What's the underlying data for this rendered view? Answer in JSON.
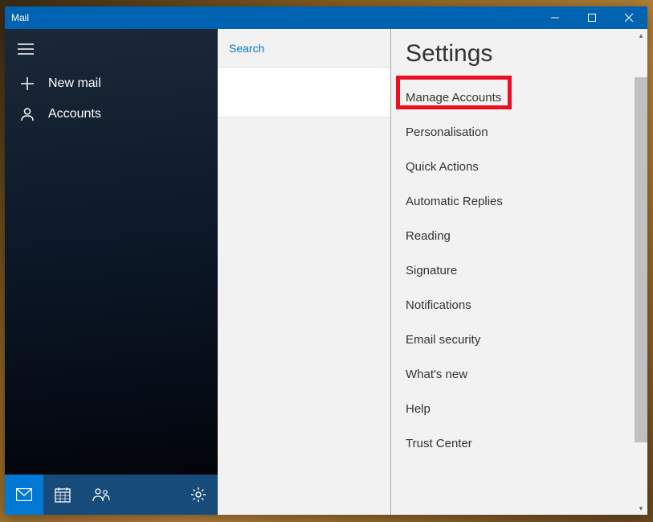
{
  "titlebar": {
    "title": "Mail"
  },
  "sidebar": {
    "new_mail": "New mail",
    "accounts": "Accounts"
  },
  "search": {
    "placeholder": "Search"
  },
  "settings": {
    "title": "Settings",
    "items": [
      "Manage Accounts",
      "Personalisation",
      "Quick Actions",
      "Automatic Replies",
      "Reading",
      "Signature",
      "Notifications",
      "Email security",
      "What's new",
      "Help",
      "Trust Center"
    ]
  }
}
